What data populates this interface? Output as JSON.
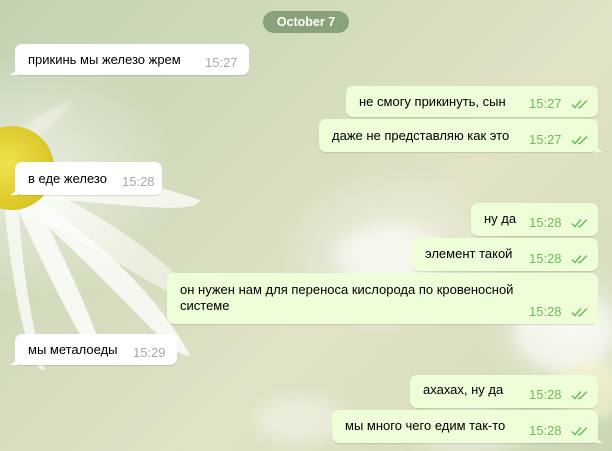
{
  "chat": {
    "date_label": "October 7",
    "messages": [
      {
        "text": "прикинь мы железо жрем",
        "time": "15:27"
      },
      {
        "text": "не смогу прикинуть, сын",
        "time": "15:27"
      },
      {
        "text": "даже не представляю как это",
        "time": "15:27"
      },
      {
        "text": "в еде железо",
        "time": "15:28"
      },
      {
        "text": "ну да",
        "time": "15:28"
      },
      {
        "text": "элемент такой",
        "time": "15:28"
      },
      {
        "text": "он нужен нам для переноса кислорода по кровеносной системе",
        "time": "15:28"
      },
      {
        "text": "мы металоеды",
        "time": "15:29"
      },
      {
        "text": "ахахах, ну да",
        "time": "15:28"
      },
      {
        "text": "мы много чего едим так-то",
        "time": "15:28"
      }
    ]
  },
  "colors": {
    "incoming_bubble": "#ffffff",
    "outgoing_bubble": "#eefed9",
    "read_ticks": "#6dbb5b",
    "date_pill": "#7a9468"
  },
  "icons": {
    "read_receipt": "double-check-icon"
  }
}
